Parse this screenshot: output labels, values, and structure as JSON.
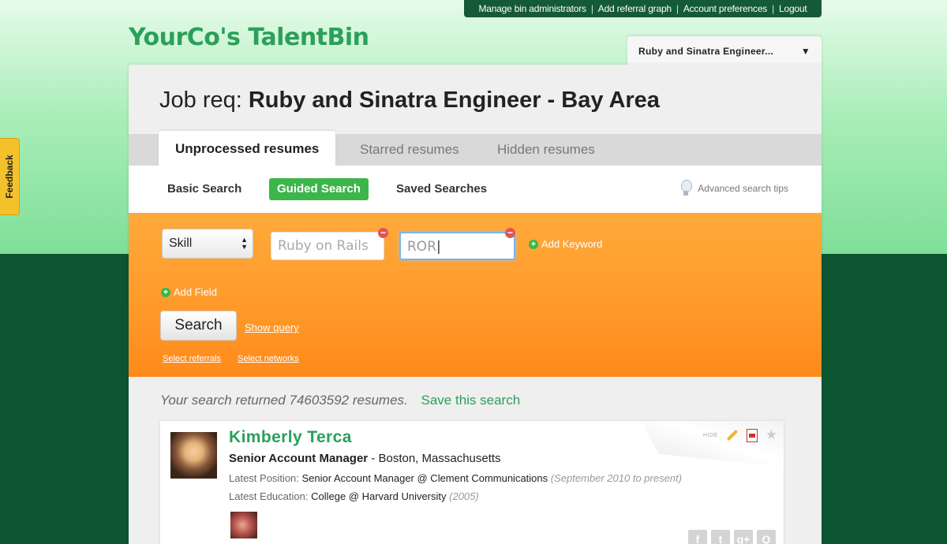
{
  "topbar": {
    "links": [
      "Manage bin administrators",
      "Add referral graph",
      "Account preferences",
      "Logout"
    ]
  },
  "logo": "YourCo's TalentBin",
  "job_dropdown": {
    "label": "Ruby and Sinatra Engineer...",
    "icon": "triangle-down-icon"
  },
  "header": {
    "prefix": "Job req:",
    "title": "Ruby and Sinatra Engineer - Bay Area"
  },
  "tabs": [
    "Unprocessed resumes",
    "Starred resumes",
    "Hidden resumes"
  ],
  "subnav": {
    "items": [
      "Basic Search",
      "Guided Search",
      "Saved Searches"
    ],
    "active": "Guided Search",
    "tips": "Advanced search tips"
  },
  "search": {
    "field_select": "Skill",
    "keyword1_placeholder": "Ruby on Rails",
    "keyword2_value": "ROR",
    "add_keyword": "Add Keyword",
    "add_field": "Add Field",
    "search_button": "Search",
    "show_query": "Show query",
    "select_referrals": "Select referrals",
    "select_networks": "Select networks"
  },
  "results": {
    "text": "Your search returned 74603592 resumes.",
    "save_search": "Save this search"
  },
  "resume": {
    "name": "Kimberly Terca",
    "title": "Senior Account Manager",
    "location": "- Boston, Massachusetts",
    "latest_position_label": "Latest Position:",
    "latest_position": "Senior Account Manager @ Clement Communications",
    "latest_position_dates": "(September 2010 to present)",
    "latest_education_label": "Latest Education:",
    "latest_education": "College @ Harvard University",
    "latest_education_dates": "(2005)",
    "hide": "HIDE",
    "social": [
      "f",
      "t",
      "g+",
      "Q"
    ]
  },
  "feedback": "Feedback",
  "colors": {
    "brand_green": "#2aa05a",
    "dark_green": "#0d5632",
    "orange": "#ff9b2b",
    "active_tab_green": "#3cb54a"
  }
}
